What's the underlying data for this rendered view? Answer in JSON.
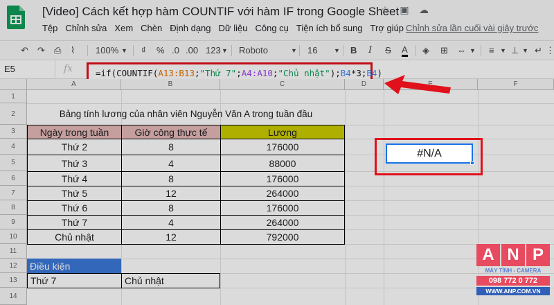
{
  "app": {
    "title": "[Video] Cách kết hợp hàm COUNTIF với hàm IF trong Google Sheet",
    "menu": [
      "Tệp",
      "Chỉnh sửa",
      "Xem",
      "Chèn",
      "Định dạng",
      "Dữ liệu",
      "Công cụ",
      "Tiện ích bổ sung",
      "Trợ giúp"
    ],
    "last_edit": "Chỉnh sửa lần cuối vài giây trước"
  },
  "toolbar": {
    "zoom": "100%",
    "currency": "₫",
    "percent": "%",
    "decimal_less": ".0",
    "decimal_more": ".00",
    "more_formats": "123",
    "font": "Roboto",
    "font_size": "16",
    "bold": "B",
    "italic": "I",
    "strike": "S",
    "text_color": "A"
  },
  "formula_bar": {
    "name_box": "E5",
    "fx": "fx",
    "parts": [
      "=if(COUNTIF(",
      "A13:B13",
      ";",
      "\"Thứ 7\"",
      ";",
      "A4:A10",
      ";",
      "\"Chủ nhật\"",
      ");",
      "B4",
      "*3;",
      "B4",
      ")"
    ]
  },
  "columns": [
    "A",
    "B",
    "C",
    "D",
    "E",
    "F"
  ],
  "rows": [
    "1",
    "2",
    "3",
    "4",
    "5",
    "6",
    "7",
    "8",
    "9",
    "10",
    "11",
    "12",
    "13",
    "14"
  ],
  "sheet": {
    "table_title": "Bảng tính lương của nhân viên Nguyễn Văn A trong tuần đầu",
    "headers": [
      "Ngày trong tuần",
      "Giờ công thực tế",
      "Lương"
    ],
    "data": [
      [
        "Thứ 2",
        "8",
        "176000"
      ],
      [
        "Thứ 3",
        "4",
        "88000"
      ],
      [
        "Thứ 4",
        "8",
        "176000"
      ],
      [
        "Thứ 5",
        "12",
        "264000"
      ],
      [
        "Thứ 6",
        "8",
        "176000"
      ],
      [
        "Thứ 7",
        "4",
        "264000"
      ],
      [
        "Chủ nhật",
        "12",
        "792000"
      ]
    ],
    "condition_label": "Điều kiện",
    "condition_values": [
      "Thứ 7",
      "Chủ nhật"
    ],
    "result": "#N/A"
  },
  "watermark": {
    "letters": [
      "A",
      "N",
      "P"
    ],
    "tagline": "MÁY TÍNH - CAMERA",
    "phone": "098 772 0 772",
    "website": "WWW.ANP.COM.VN"
  },
  "colors": {
    "header_a": "#e6b8b8",
    "header_b": "#e6b8b8",
    "header_c": "#cccc00",
    "condition_fill": "#3c78d8",
    "highlight_red": "#e0111a",
    "selection_blue": "#1a73e8"
  }
}
